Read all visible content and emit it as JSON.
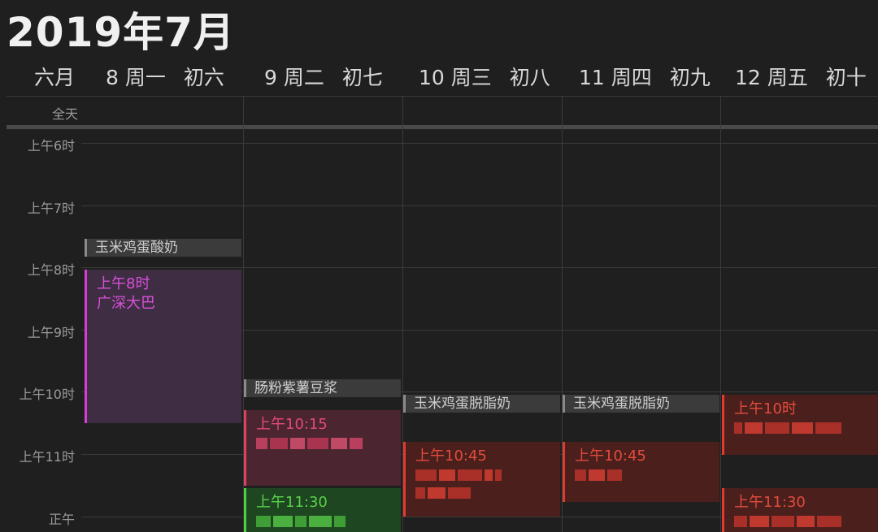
{
  "title": "2019年7月",
  "lunar_month": "六月",
  "allday_label": "全天",
  "days": [
    {
      "date": "8",
      "weekday": "周一",
      "lunar": "初六"
    },
    {
      "date": "9",
      "weekday": "周二",
      "lunar": "初七"
    },
    {
      "date": "10",
      "weekday": "周三",
      "lunar": "初八"
    },
    {
      "date": "11",
      "weekday": "周四",
      "lunar": "初九"
    },
    {
      "date": "12",
      "weekday": "周五",
      "lunar": "初十"
    }
  ],
  "hours": [
    "上午6时",
    "上午7时",
    "上午8时",
    "上午9时",
    "上午10时",
    "上午11时",
    "正午"
  ],
  "chips": {
    "mon": "玉米鸡蛋酸奶",
    "tue": "肠粉紫薯豆浆",
    "wed": "玉米鸡蛋脱脂奶",
    "thu": "玉米鸡蛋脱脂奶"
  },
  "events": {
    "mon_bus": {
      "time": "上午8时",
      "name": "广深大巴"
    },
    "tue_1015": {
      "time": "上午10:15"
    },
    "tue_1130": {
      "time": "上午11:30"
    },
    "wed_1045": {
      "time": "上午10:45"
    },
    "thu_1045": {
      "time": "上午10:45"
    },
    "fri_10": {
      "time": "上午10时"
    },
    "fri_1130": {
      "time": "上午11:30"
    }
  },
  "colors": {
    "purple_bg": "#3f2d44",
    "purple_fg": "#d950d9",
    "purple_bar": "#d63fd6",
    "pink_bg": "#4b2530",
    "pink_bar": "#e0405f",
    "green_bg": "#1e4621",
    "green_fg": "#59d24a",
    "green_bar": "#4cd23f",
    "red_bg": "#4b1f1c",
    "red_fg": "#e24b3e",
    "red_bar": "#e23a2e"
  }
}
